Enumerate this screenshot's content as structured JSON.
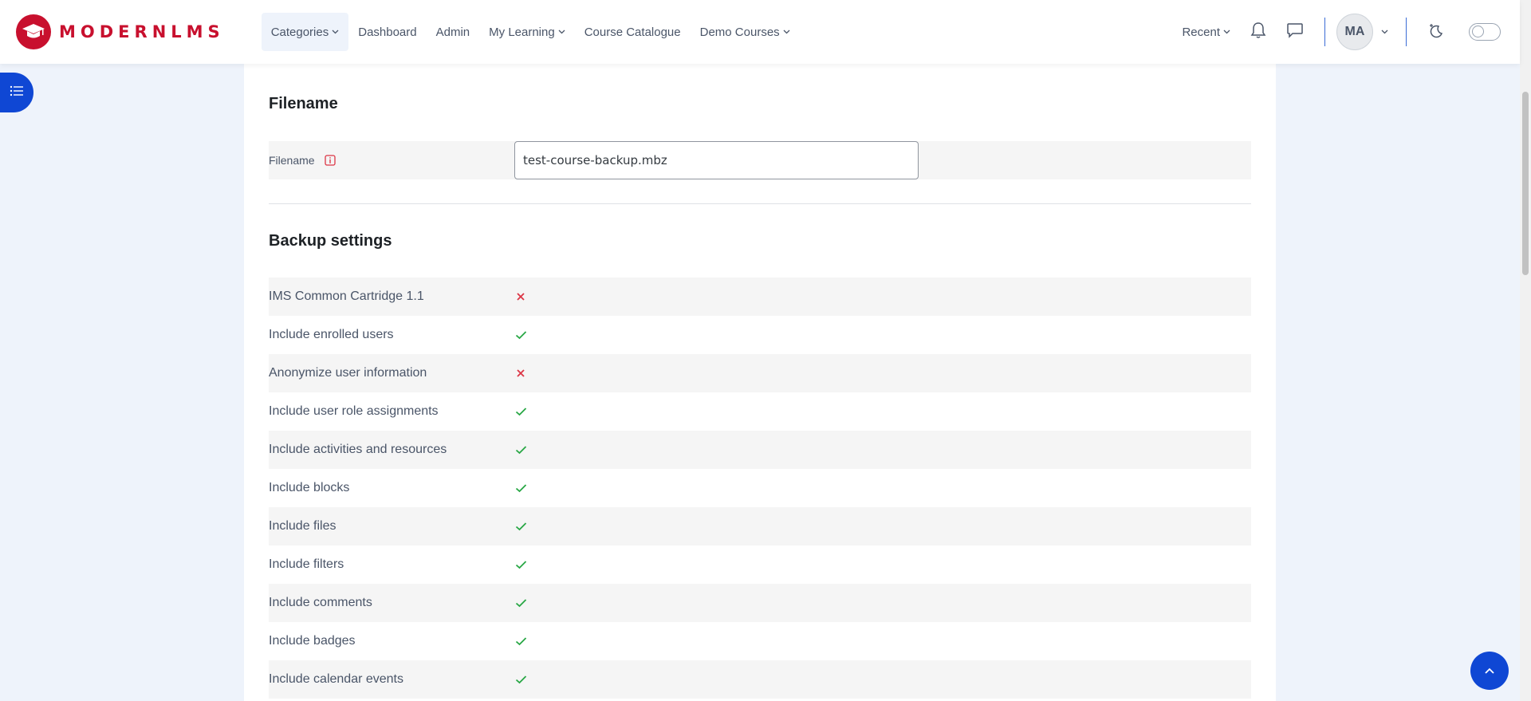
{
  "brand": {
    "name": "MODERNLMS"
  },
  "nav": {
    "categories": "Categories",
    "dashboard": "Dashboard",
    "admin": "Admin",
    "my_learning": "My Learning",
    "course_catalogue": "Course Catalogue",
    "demo_courses": "Demo Courses"
  },
  "header_right": {
    "recent": "Recent",
    "avatar_initials": "MA"
  },
  "filename_section": {
    "title": "Filename",
    "label": "Filename",
    "value": "test-course-backup.mbz"
  },
  "backup_section": {
    "title": "Backup settings",
    "settings": [
      {
        "label": "IMS Common Cartridge 1.1",
        "enabled": false
      },
      {
        "label": "Include enrolled users",
        "enabled": true
      },
      {
        "label": "Anonymize user information",
        "enabled": false
      },
      {
        "label": "Include user role assignments",
        "enabled": true
      },
      {
        "label": "Include activities and resources",
        "enabled": true
      },
      {
        "label": "Include blocks",
        "enabled": true
      },
      {
        "label": "Include files",
        "enabled": true
      },
      {
        "label": "Include filters",
        "enabled": true
      },
      {
        "label": "Include comments",
        "enabled": true
      },
      {
        "label": "Include badges",
        "enabled": true
      },
      {
        "label": "Include calendar events",
        "enabled": true
      }
    ]
  },
  "colors": {
    "brand_red": "#c8102e",
    "primary_blue": "#0f47d4",
    "check_green": "#28a745",
    "cross_red": "#dc3545"
  }
}
